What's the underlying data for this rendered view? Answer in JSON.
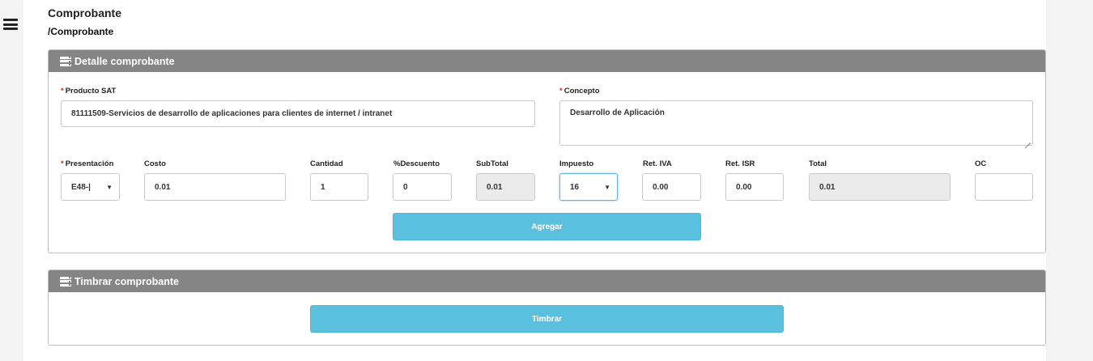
{
  "header": {
    "title": "Comprobante",
    "breadcrumb": "/Comprobante"
  },
  "detalle": {
    "panel_title": "Detalle comprobante",
    "producto_sat": {
      "label": "Producto SAT",
      "value": "81111509-Servicios de desarrollo de aplicaciones para clientes de internet / intranet"
    },
    "concepto": {
      "label": "Concepto",
      "value": "Desarrollo de Aplicación"
    },
    "presentacion": {
      "label": "Presentación",
      "value": "E48-|"
    },
    "costo": {
      "label": "Costo",
      "value": "0.01"
    },
    "cantidad": {
      "label": "Cantidad",
      "value": "1"
    },
    "descuento": {
      "label": "%Descuento",
      "value": "0"
    },
    "subtotal": {
      "label": "SubTotal",
      "value": "0.01"
    },
    "impuesto": {
      "label": "Impuesto",
      "value": "16"
    },
    "ret_iva": {
      "label": "Ret. IVA",
      "value": "0.00"
    },
    "ret_isr": {
      "label": "Ret. ISR",
      "value": "0.00"
    },
    "total": {
      "label": "Total",
      "value": "0.01"
    },
    "oc": {
      "label": "OC",
      "value": ""
    },
    "required_mark": "*",
    "agregar_label": "Agregar"
  },
  "timbrar": {
    "panel_title": "Timbrar comprobante",
    "button_label": "Timbrar"
  },
  "colors": {
    "panel_header": "#858585",
    "button": "#5bc0de",
    "required": "#d9231d"
  },
  "icons": {
    "menu": "hamburger-icon",
    "panel": "server-icon",
    "dropdown": "caret-down-icon"
  }
}
